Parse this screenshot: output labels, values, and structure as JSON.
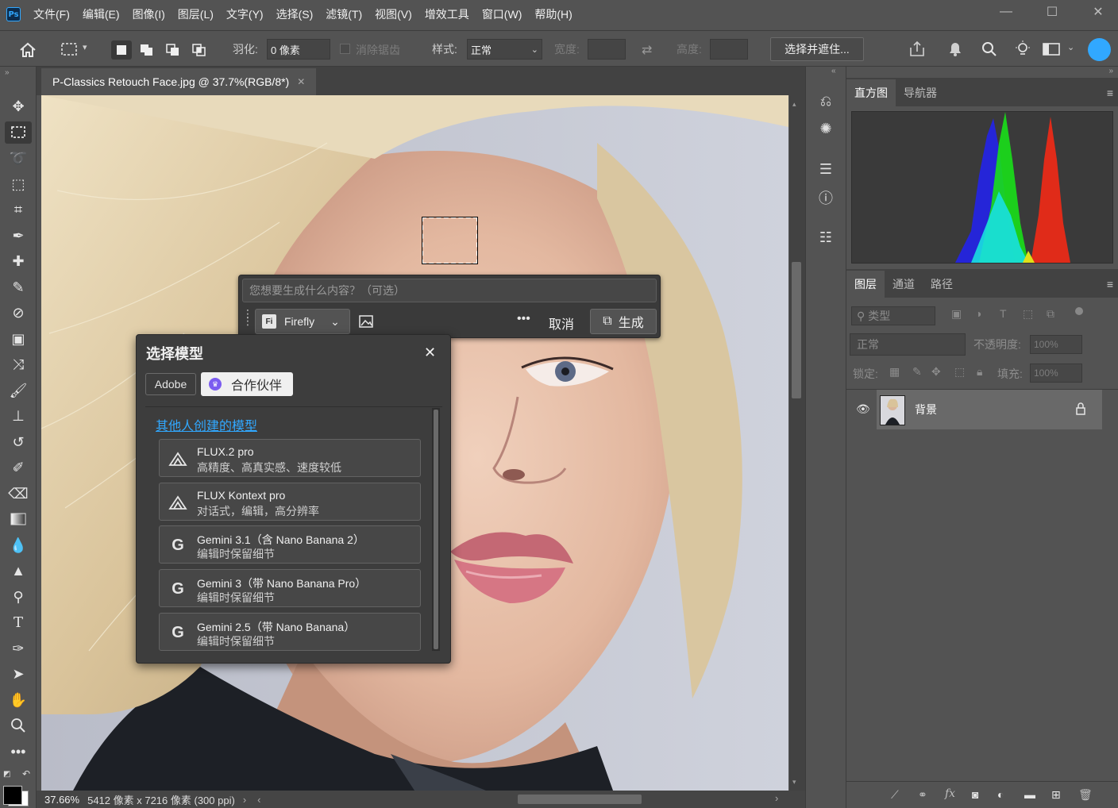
{
  "menu": {
    "logo": "Ps",
    "items": [
      "文件(F)",
      "编辑(E)",
      "图像(I)",
      "图层(L)",
      "文字(Y)",
      "选择(S)",
      "滤镜(T)",
      "视图(V)",
      "增效工具",
      "窗口(W)",
      "帮助(H)"
    ]
  },
  "options": {
    "feather_label": "羽化:",
    "feather_value": "0 像素",
    "antialias_label": "消除锯齿",
    "style_label": "样式:",
    "style_value": "正常",
    "width_label": "宽度:",
    "height_label": "高度:",
    "select_mask_button": "选择并遮住..."
  },
  "document": {
    "tab_title": "P-Classics Retouch Face.jpg @ 37.7%(RGB/8*)"
  },
  "status": {
    "zoom": "37.66%",
    "info": "5412 像素 x 7216 像素 (300 ppi)"
  },
  "genfill": {
    "prompt_placeholder": "您想要生成什么内容？（可选）",
    "model_label": "Firefly",
    "cancel_label": "取消",
    "generate_label": "生成"
  },
  "model_popup": {
    "title": "选择模型",
    "tab_adobe": "Adobe",
    "tab_partners": "合作伙伴",
    "section_link": "其他人创建的模型",
    "models": [
      {
        "name": "FLUX.2 pro",
        "desc": "高精度、高真实感、速度较低",
        "logo": "flux"
      },
      {
        "name": "FLUX Kontext pro",
        "desc": "对话式，编辑，高分辨率",
        "logo": "flux"
      },
      {
        "name": "Gemini 3.1（含 Nano Banana 2）",
        "desc": "编辑时保留细节",
        "logo": "G"
      },
      {
        "name": "Gemini 3（带 Nano Banana Pro）",
        "desc": "编辑时保留细节",
        "logo": "G"
      },
      {
        "name": "Gemini 2.5（带 Nano Banana）",
        "desc": "编辑时保留细节",
        "logo": "G"
      }
    ]
  },
  "histogram": {
    "tabs": [
      "直方图",
      "导航器"
    ]
  },
  "layers_panel": {
    "tabs": [
      "图层",
      "通道",
      "路径"
    ],
    "filter_placeholder": "类型",
    "blend_mode": "正常",
    "opacity_label": "不透明度:",
    "opacity_value": "100%",
    "lock_label": "锁定:",
    "fill_label": "填充:",
    "fill_value": "100%",
    "layers": [
      {
        "name": "背景",
        "visible": true,
        "locked": true
      }
    ]
  },
  "colors": {
    "accent": "#31a8ff",
    "panel_bg": "#535353",
    "dark_bg": "#424242",
    "partner_badge": "#7b5cf0"
  }
}
